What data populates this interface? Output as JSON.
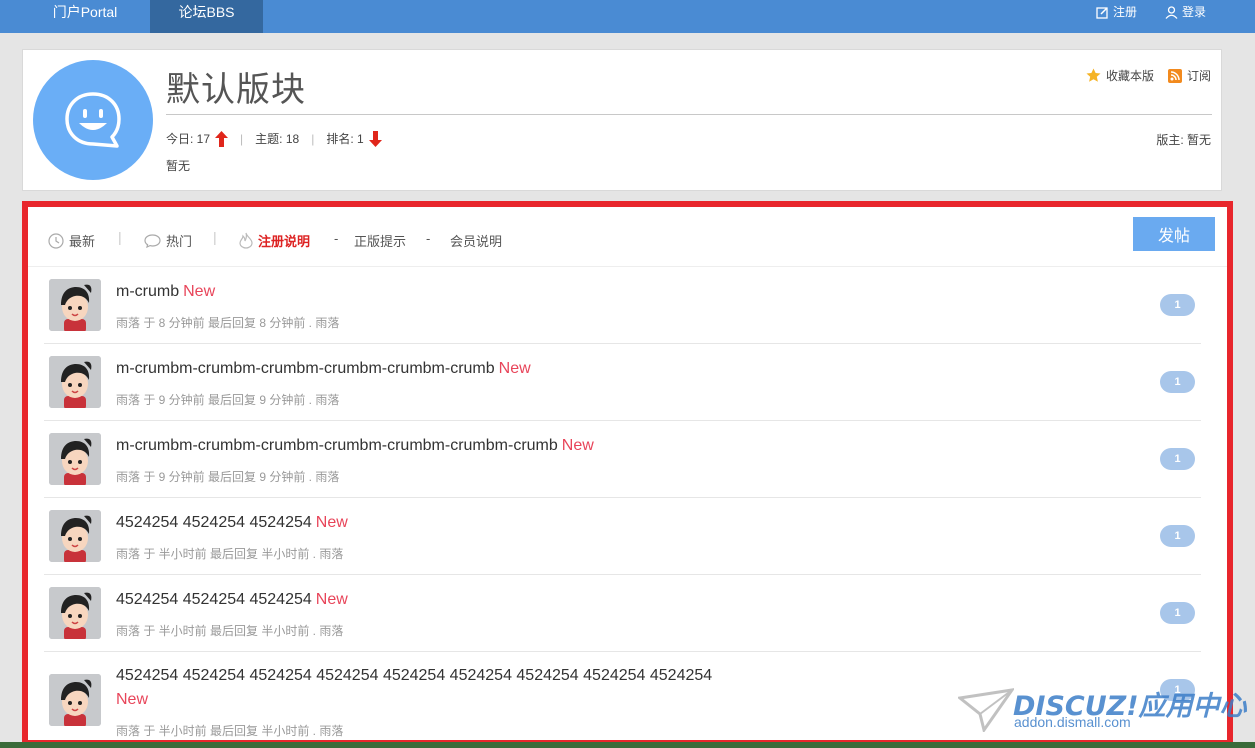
{
  "nav": {
    "tabs": [
      {
        "label": "门户Portal",
        "active": false
      },
      {
        "label": "论坛BBS",
        "active": true
      }
    ],
    "register_label": "注册",
    "login_label": "登录",
    "color": "#4a8bd3"
  },
  "forum": {
    "title": "默认版块",
    "today_label": "今日: 17",
    "topics_label": "主题: 18",
    "rank_label": "排名: 1",
    "description": "暂无",
    "favorite_label": "收藏本版",
    "subscribe_label": "订阅",
    "moderator_label": "版主: 暂无"
  },
  "list": {
    "tabs": {
      "latest": "最新",
      "hot": "热门",
      "notice1": "注册说明",
      "notice2": "正版提示",
      "notice3": "会员说明",
      "dash": "-"
    },
    "post_button": "发帖",
    "threads": [
      {
        "title": "m-crumb",
        "new": "New",
        "meta": "雨落 于 8 分钟前 最后回复 8 分钟前 . 雨落",
        "count": "1"
      },
      {
        "title": "m-crumbm-crumbm-crumbm-crumbm-crumbm-crumb",
        "new": "New",
        "meta": "雨落 于 9 分钟前 最后回复 9 分钟前 . 雨落",
        "count": "1"
      },
      {
        "title": "m-crumbm-crumbm-crumbm-crumbm-crumbm-crumbm-crumb",
        "new": "New",
        "meta": "雨落 于 9 分钟前 最后回复 9 分钟前 . 雨落",
        "count": "1"
      },
      {
        "title": "4524254 4524254 4524254",
        "new": "New",
        "meta": "雨落 于 半小时前 最后回复 半小时前 . 雨落",
        "count": "1"
      },
      {
        "title": "4524254 4524254 4524254",
        "new": "New",
        "meta": "雨落 于 半小时前 最后回复 半小时前 . 雨落",
        "count": "1"
      },
      {
        "title": "4524254 4524254 4524254 4524254 4524254 4524254 4524254 4524254 4524254",
        "new": "New",
        "meta": "雨落 于 半小时前 最后回复 半小时前 . 雨落",
        "count": "1"
      }
    ]
  },
  "watermark": {
    "brand": "DISCUZ!应用中心",
    "url": "addon.dismall.com"
  }
}
